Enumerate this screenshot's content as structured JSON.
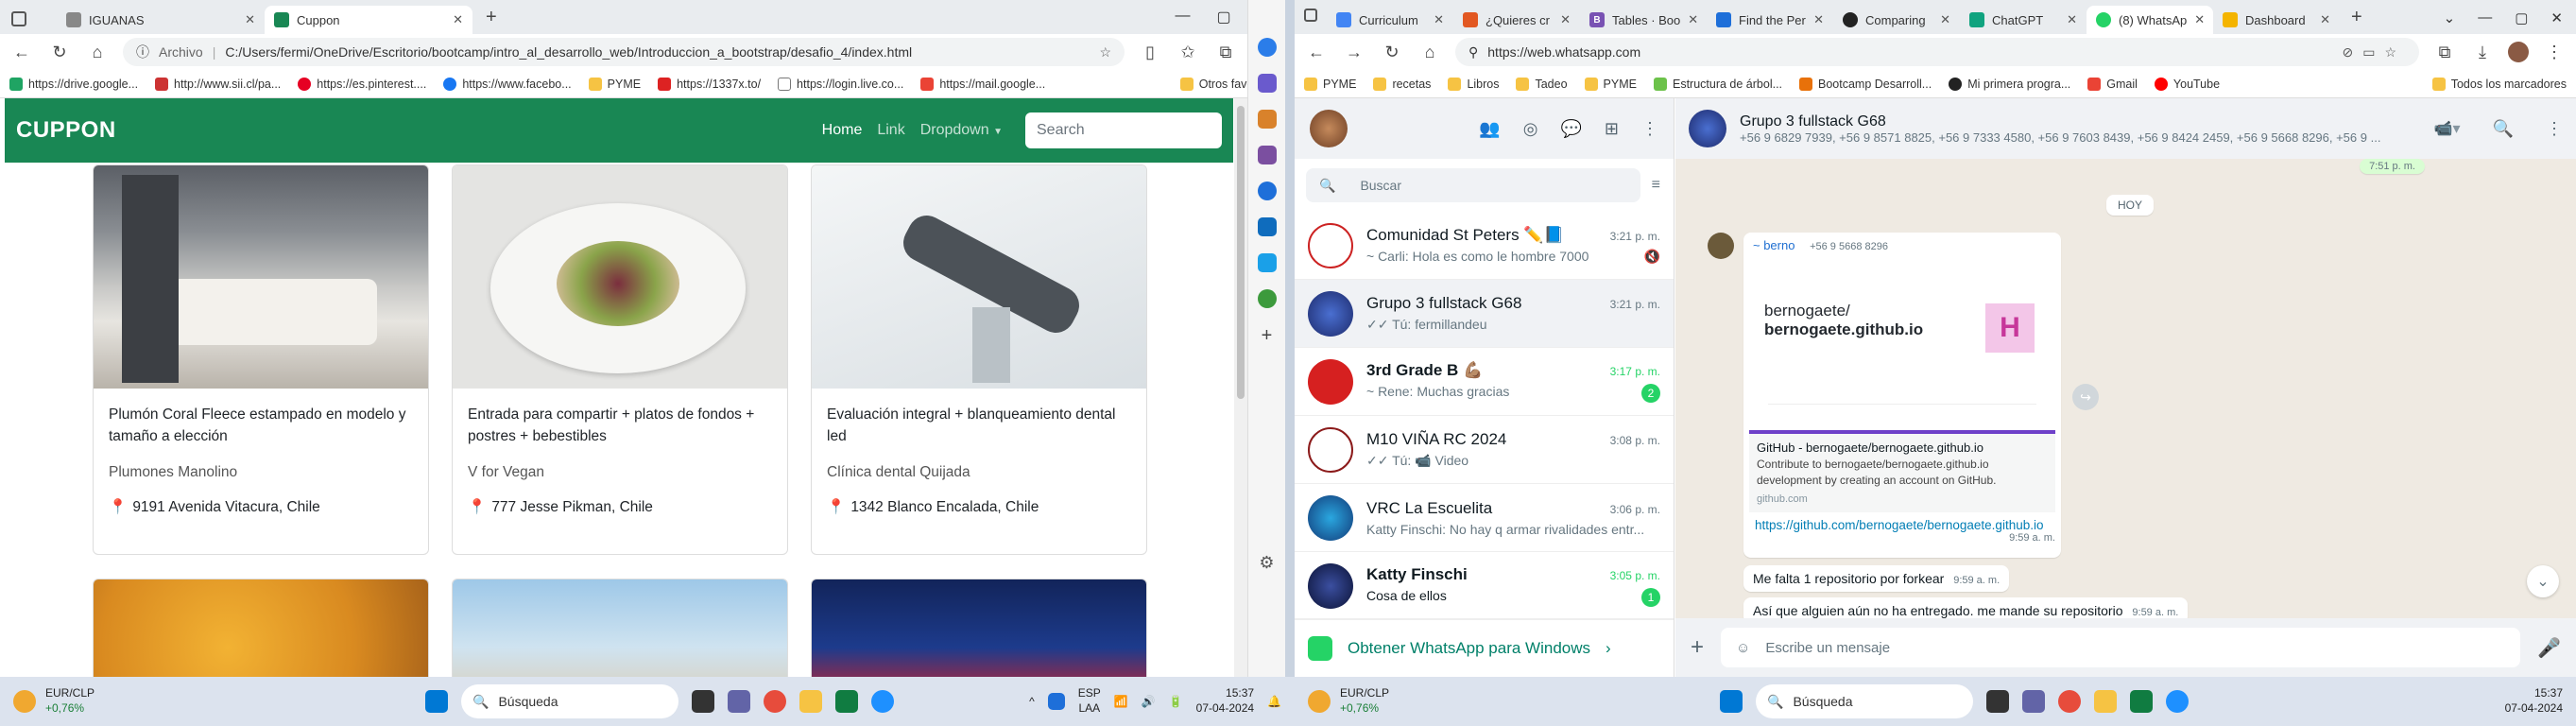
{
  "left_browser": {
    "tabs": [
      {
        "title": "IGUANAS",
        "active": false
      },
      {
        "title": "Cuppon",
        "active": true
      }
    ],
    "address": {
      "prefix": "Archivo",
      "url": "C:/Users/fermi/OneDrive/Escritorio/bootcamp/intro_al_desarrollo_web/Introduccion_a_bootstrap/desafio_4/index.html"
    },
    "bookmarks": [
      "https://drive.google...",
      "http://www.sii.cl/pa...",
      "https://es.pinterest....",
      "https://www.facebo...",
      "PYME",
      "https://1337x.to/",
      "https://login.live.co...",
      "https://mail.google..."
    ],
    "other_favorites": "Otros favoritos"
  },
  "cuppon": {
    "brand": "CUPPON",
    "nav": {
      "home": "Home",
      "link": "Link",
      "dropdown": "Dropdown"
    },
    "search_placeholder": "Search",
    "cards": [
      {
        "title": "Plumón Coral Fleece estampado en modelo y tamaño a elección",
        "vendor": "Plumones Manolino",
        "address": "9191 Avenida Vitacura, Chile"
      },
      {
        "title": "Entrada para compartir + platos de fondos + postres + bebestibles",
        "vendor": "V for Vegan",
        "address": "777 Jesse Pikman, Chile"
      },
      {
        "title": "Evaluación integral + blanqueamiento dental led",
        "vendor": "Clínica dental Quijada",
        "address": "1342 Blanco Encalada, Chile"
      }
    ]
  },
  "right_browser": {
    "tabs": [
      "Curriculum",
      "¿Quieres cr",
      "Tables · Boo",
      "Find the Per",
      "Comparing",
      "ChatGPT",
      "(8) WhatsAp",
      "Dashboard"
    ],
    "url": "https://web.whatsapp.com",
    "bookmarks": [
      "PYME",
      "recetas",
      "Libros",
      "Tadeo",
      "PYME",
      "Estructura de árbol...",
      "Bootcamp Desarroll...",
      "Mi primera progra...",
      "Gmail",
      "YouTube"
    ],
    "all_bookmarks": "Todos los marcadores"
  },
  "whatsapp": {
    "search_placeholder": "Buscar",
    "chats": [
      {
        "name": "Comunidad St Peters ✏️📘",
        "time": "3:21 p. m.",
        "msg": "~ Carli: Hola es como le hombre 7000",
        "badge": ""
      },
      {
        "name": "Grupo 3 fullstack G68",
        "time": "3:21 p. m.",
        "msg": "✓✓ Tú: fermillandeu",
        "badge": ""
      },
      {
        "name": "3rd Grade B 💪🏽",
        "time": "3:17 p. m.",
        "msg": "~ Rene: Muchas gracias",
        "badge": "2"
      },
      {
        "name": "M10 VIÑA RC 2024",
        "time": "3:08 p. m.",
        "msg": "✓✓ Tú: 📹 Video",
        "badge": ""
      },
      {
        "name": "VRC La Escuelita",
        "time": "3:06 p. m.",
        "msg": "Katty Finschi: No hay q armar rivalidades entr...",
        "badge": ""
      },
      {
        "name": "Katty Finschi",
        "time": "3:05 p. m.",
        "msg": "Cosa de ellos",
        "badge": "1"
      }
    ],
    "get_windows": "Obtener WhatsApp para Windows",
    "conversation": {
      "title": "Grupo 3 fullstack G68",
      "members": "+56 9 6829 7939, +56 9 8571 8825, +56 9 7333 4580, +56 9 7603 8439, +56 9 8424 2459, +56 9 5668 8296, +56 9 ...",
      "prev_time": "7:51 p. m.",
      "day": "HOY",
      "sender": "~ berno",
      "sender_phone": "+56 9 5668 8296",
      "preview_repo": "bernogaete/",
      "preview_repo_bold": "bernogaete.github.io",
      "preview_title": "GitHub - bernogaete/bernogaete.github.io",
      "preview_desc": "Contribute to bernogaete/bernogaete.github.io development by creating an account on GitHub.",
      "preview_domain": "github.com",
      "preview_link": "https://github.com/bernogaete/bernogaete.github.io",
      "preview_time": "9:59 a. m.",
      "msg2": "Me falta 1 repositorio por forkear",
      "msg2_time": "9:59 a. m.",
      "msg3": "Así que alguien aún no ha entregado. me mande su repositorio",
      "msg3_time": "9:59 a. m.",
      "composer_placeholder": "Escribe un mensaje"
    }
  },
  "taskbar": {
    "currency": "EUR/CLP",
    "change": "+0,76%",
    "search": "Búsqueda",
    "lang": "ESP",
    "lang2": "LAA",
    "time": "15:37",
    "date": "07-04-2024",
    "colors": {
      "accent": "#198754",
      "wa_green": "#25d366"
    }
  }
}
